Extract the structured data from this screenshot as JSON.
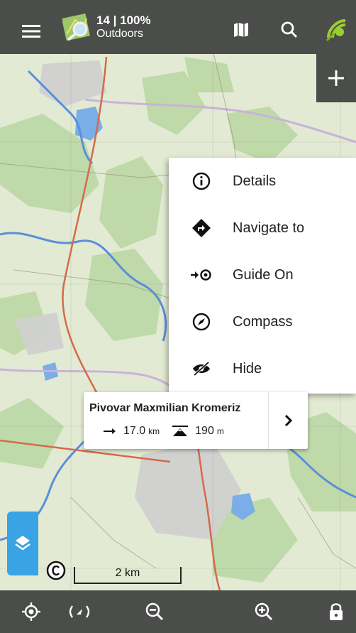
{
  "topbar": {
    "zoom_info": "14 | 100%",
    "map_name": "Outdoors"
  },
  "context_menu": {
    "items": [
      {
        "label": "Details",
        "icon": "info-icon"
      },
      {
        "label": "Navigate to",
        "icon": "navigate-icon"
      },
      {
        "label": "Guide On",
        "icon": "guide-icon"
      },
      {
        "label": "Compass",
        "icon": "compass-icon"
      },
      {
        "label": "Hide",
        "icon": "hide-icon"
      }
    ]
  },
  "point_card": {
    "title": "Pivovar Maxmilian Kromeriz",
    "distance_value": "17.0",
    "distance_unit": "km",
    "elevation_value": "190",
    "elevation_unit": "m"
  },
  "scale": {
    "label": "2 km"
  },
  "colors": {
    "bar": "#4a4d4a",
    "accent": "#3aa3e3",
    "gps": "#9acd32"
  }
}
